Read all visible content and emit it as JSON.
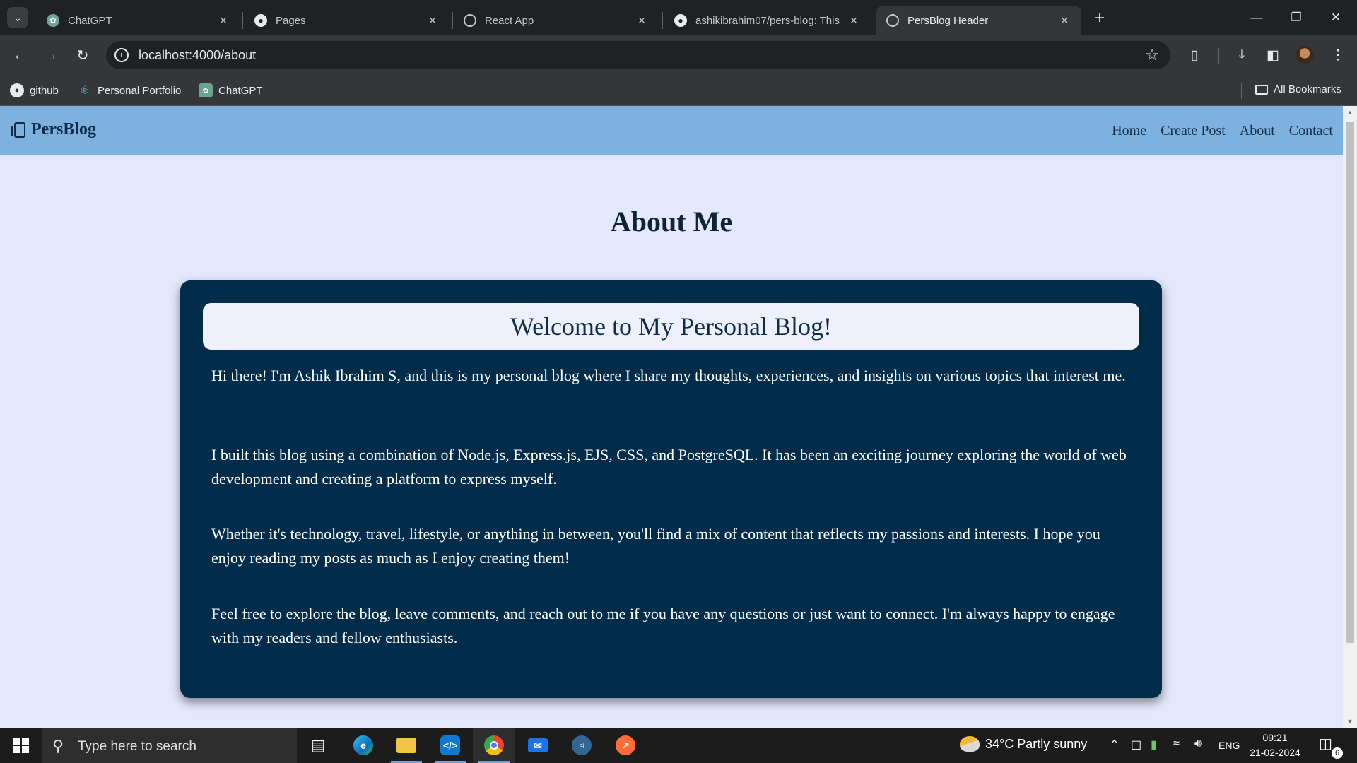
{
  "browser": {
    "tabs": [
      {
        "title": "ChatGPT",
        "icon": "chatgpt-icon"
      },
      {
        "title": "Pages",
        "icon": "github-icon"
      },
      {
        "title": "React App",
        "icon": "globe-icon"
      },
      {
        "title": "ashikibrahim07/pers-blog: This",
        "icon": "github-icon"
      },
      {
        "title": "PersBlog Header",
        "icon": "globe-icon",
        "active": true
      }
    ],
    "url": "localhost:4000/about",
    "bookmarks": [
      {
        "label": "github",
        "icon": "github-icon"
      },
      {
        "label": "Personal Portfolio",
        "icon": "react-icon"
      },
      {
        "label": "ChatGPT",
        "icon": "chatgpt-icon"
      }
    ],
    "all_bookmarks_label": "All Bookmarks"
  },
  "site": {
    "brand": "PersBlog",
    "nav": [
      "Home",
      "Create Post",
      "About",
      "Contact"
    ],
    "nav_color": "#7fb1de",
    "page_background": "#e3e8fb"
  },
  "about": {
    "heading": "About Me",
    "card_title": "Welcome to My Personal Blog!",
    "card_color": "#012d4a",
    "paragraphs": [
      "Hi there! I'm Ashik Ibrahim S, and this is my personal blog where I share my thoughts, experiences, and insights on various topics that interest me.",
      "I built this blog using a combination of Node.js, Express.js, EJS, CSS, and PostgreSQL. It has been an exciting journey exploring the world of web development and creating a platform to express myself.",
      "Whether it's technology, travel, lifestyle, or anything in between, you'll find a mix of content that reflects my passions and interests. I hope you enjoy reading my posts as much as I enjoy creating them!",
      "Feel free to explore the blog, leave comments, and reach out to me if you have any questions or just want to connect. I'm always happy to engage with my readers and fellow enthusiasts."
    ]
  },
  "taskbar": {
    "search_placeholder": "Type here to search",
    "weather": "34°C  Partly sunny",
    "language": "ENG",
    "time": "09:21",
    "date": "21-02-2024",
    "notification_count": "6"
  }
}
